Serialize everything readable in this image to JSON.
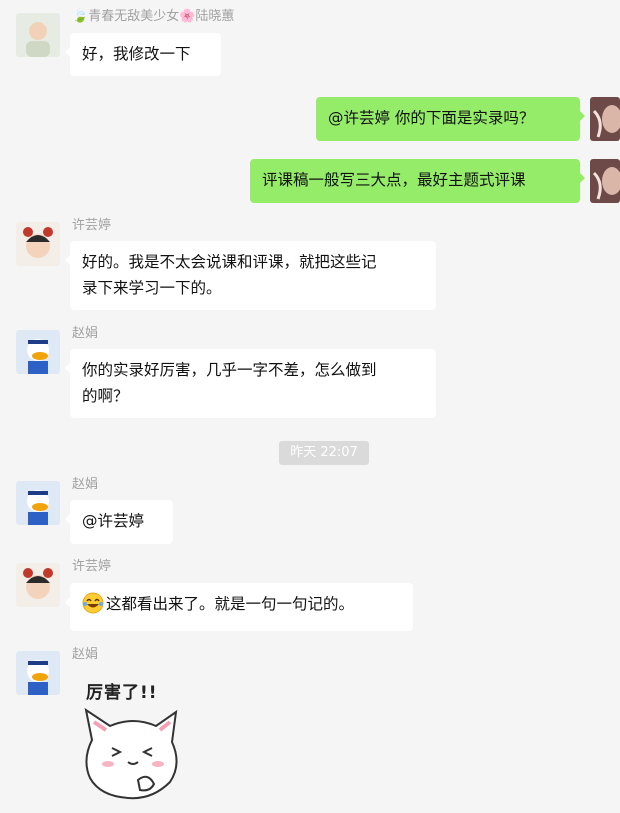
{
  "messages": [
    {
      "sender": "青春无敌美少女陆晓蕙",
      "text": "好，我修改一下"
    },
    {
      "text": "@许芸婷 你的下面是实录吗？"
    },
    {
      "text": "评课稿一般写三大点，最好主题式评课"
    },
    {
      "sender": "许芸婷",
      "text_line1": "好的。我是不太会说课和评课，就把这些记",
      "text_line2": "录下来学习一下的。"
    },
    {
      "sender": "赵娟",
      "text_line1": "你的实录好厉害，几乎一字不差，怎么做到",
      "text_line2": "的啊？"
    },
    {
      "sender": "赵娟",
      "text": "@许芸婷"
    },
    {
      "sender": "许芸婷",
      "text": "这都看出来了。就是一句一句记的。"
    },
    {
      "sender": "赵娟",
      "sticker_text": "厉害了!!"
    }
  ],
  "timestamp": "昨天 22:07",
  "colors": {
    "bg": "#f5f5f5",
    "sent_bubble": "#95ec69",
    "received_bubble": "#ffffff",
    "name": "#a2a2a2"
  },
  "icons": {
    "name_prefix": "leaf-icon",
    "name_middle": "flower-icon",
    "emoji": "laughing-tears-emoji",
    "sticker": "cat-sticker"
  }
}
